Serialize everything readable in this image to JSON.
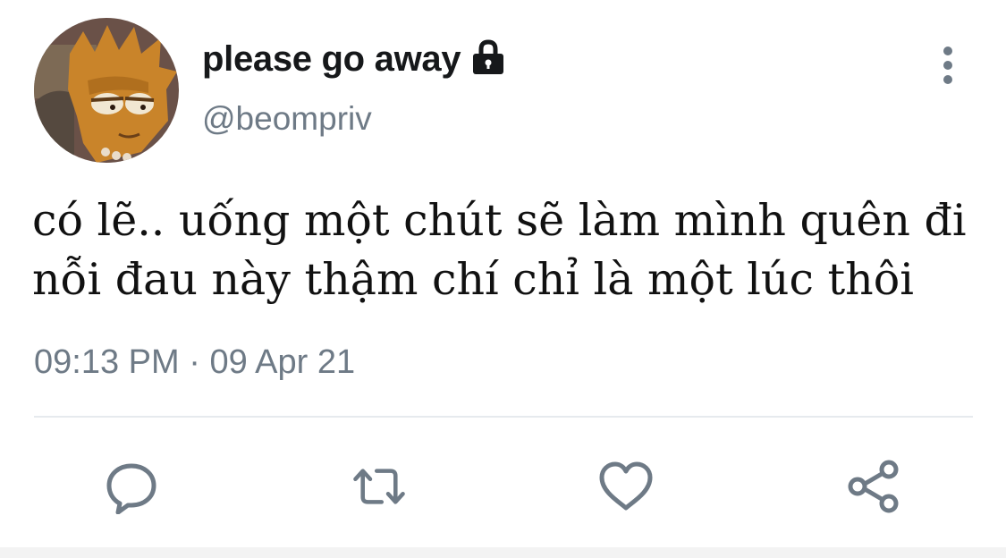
{
  "author": {
    "display_name": "please go away",
    "handle": "@beompriv",
    "avatar_icon": "cartoon-character-avatar",
    "protected_icon": "lock-icon"
  },
  "tweet": {
    "lines": [
      "có lẽ.. uống một chút sẽ làm mình quên đi",
      "nỗi đau này thậm chí chỉ là một lúc thôi"
    ]
  },
  "meta": {
    "time": "09:13 PM",
    "separator": "·",
    "date": "09 Apr 21"
  },
  "actions": [
    {
      "name": "reply",
      "icon": "reply-icon"
    },
    {
      "name": "retweet",
      "icon": "retweet-icon"
    },
    {
      "name": "like",
      "icon": "heart-icon"
    },
    {
      "name": "share",
      "icon": "share-icon"
    }
  ],
  "colors": {
    "icon": "#6e7a86",
    "text": "#111111",
    "secondary": "#6e7a86",
    "divider": "#e6eaee"
  }
}
